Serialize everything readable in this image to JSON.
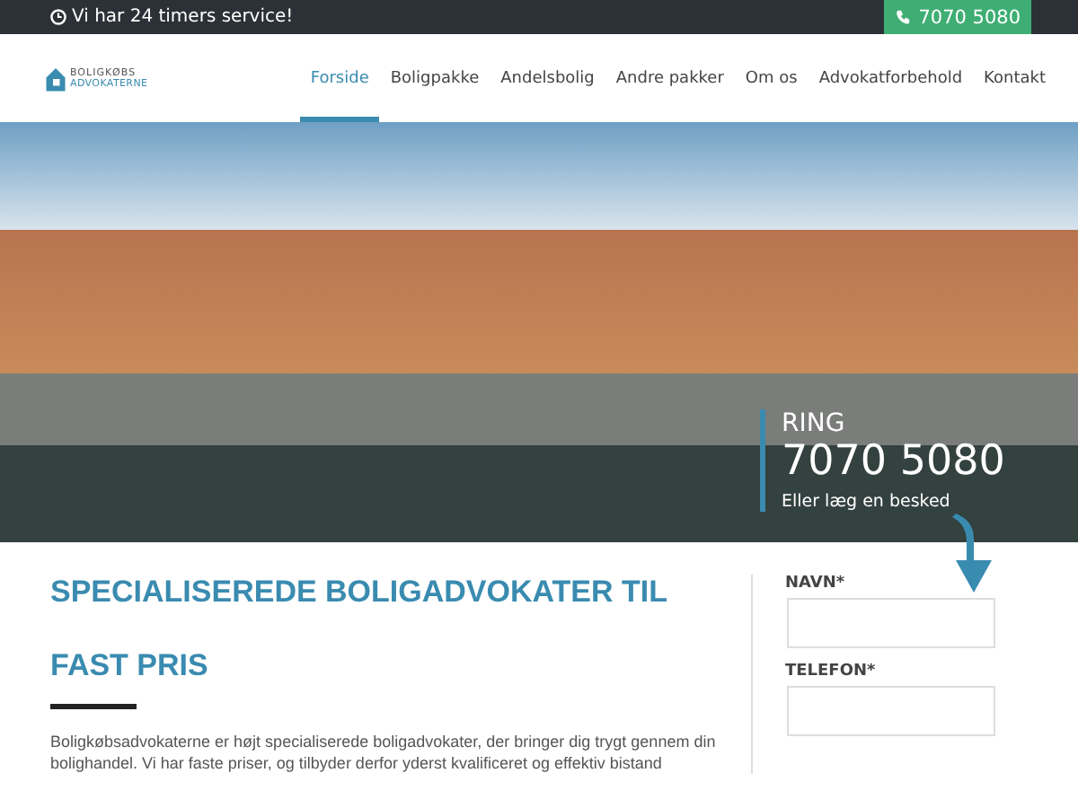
{
  "topbar": {
    "service_text": "Vi har 24 timers service!",
    "phone": "7070 5080"
  },
  "header": {
    "logo_line_1": "BOLIGKØBS",
    "logo_line_2": "ADVOKATERNE",
    "nav": [
      {
        "label": "Forside",
        "selected": true
      },
      {
        "label": "Boligpakke",
        "selected": false
      },
      {
        "label": "Andelsbolig",
        "selected": false
      },
      {
        "label": "Andre pakker",
        "selected": false
      },
      {
        "label": "Om os",
        "selected": false
      },
      {
        "label": "Advokatforbehold",
        "selected": false
      },
      {
        "label": "Kontakt",
        "selected": false
      }
    ]
  },
  "hero": {
    "call_label": "RING",
    "call_number": "7070 5080",
    "call_sub": "Eller læg en besked"
  },
  "content": {
    "heading_line_1": "SPECIALISEREDE BOLIGADVOKATER TIL",
    "heading_line_2": "FAST PRIS",
    "paragraph": "Boligkøbsadvokaterne er højt specialiserede boligadvokater, der bringer dig trygt gennem din bolighandel. Vi har faste priser, og tilbyder derfor yderst kvalificeret og effektiv bistand"
  },
  "form": {
    "fields": [
      {
        "label": "NAVN*"
      },
      {
        "label": "TELEFON*"
      }
    ]
  }
}
